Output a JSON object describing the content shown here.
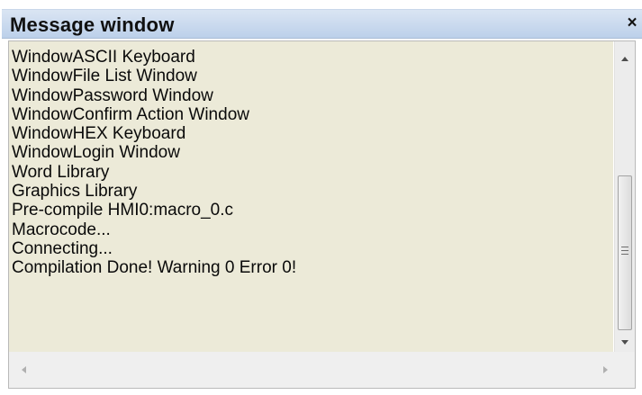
{
  "window": {
    "title": "Message window",
    "close_label": "×"
  },
  "log": {
    "lines": [
      "WindowASCII Keyboard",
      "WindowFile List Window",
      "WindowPassword Window",
      "WindowConfirm Action Window",
      "WindowHEX Keyboard",
      "WindowLogin Window",
      "Word Library",
      "Graphics Library",
      "Pre-compile HMI0:macro_0.c",
      "Macrocode...",
      "Connecting...",
      "Compilation Done! Warning 0 Error 0!"
    ]
  },
  "icons": {
    "close": "close-icon",
    "scroll_up": "chevron-up-icon",
    "scroll_down": "chevron-down-icon",
    "scroll_left": "chevron-left-icon",
    "scroll_right": "chevron-right-icon",
    "thumb_grip": "grip-icon"
  },
  "colors": {
    "titlebar": "#bcd0ea",
    "content_background": "#ecead8"
  }
}
